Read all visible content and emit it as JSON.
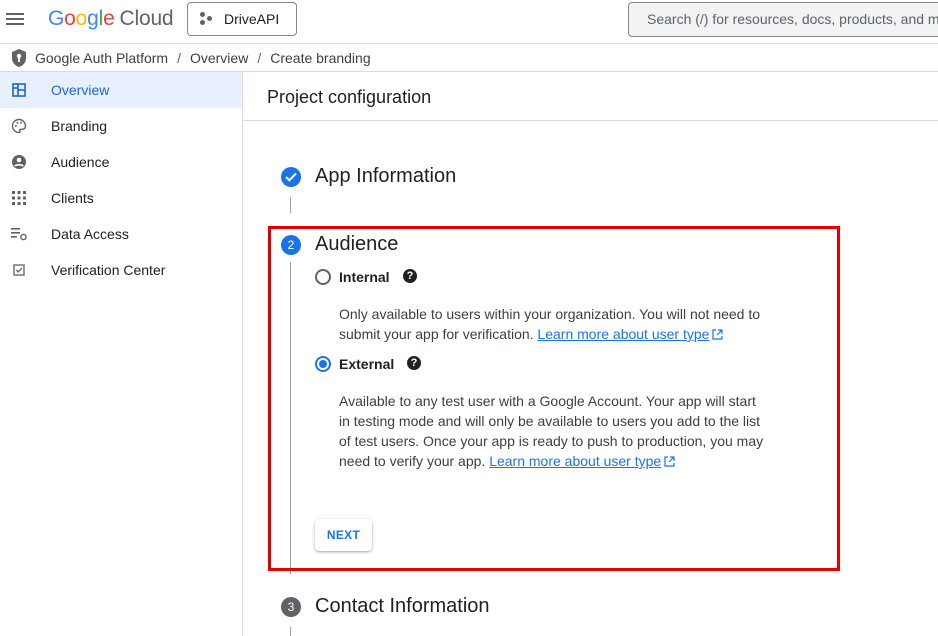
{
  "topbar": {
    "logo_google": [
      "G",
      "o",
      "o",
      "g",
      "l",
      "e"
    ],
    "logo_cloud": "Cloud",
    "project_name": "DriveAPI",
    "search_placeholder": "Search (/) for resources, docs, products, and m"
  },
  "breadcrumb": {
    "items": [
      "Google Auth Platform",
      "Overview",
      "Create branding"
    ],
    "separator": "/"
  },
  "sidebar": {
    "items": [
      {
        "label": "Overview",
        "icon": "dashboard-icon",
        "active": true
      },
      {
        "label": "Branding",
        "icon": "palette-icon",
        "active": false
      },
      {
        "label": "Audience",
        "icon": "account-circle-icon",
        "active": false
      },
      {
        "label": "Clients",
        "icon": "apps-grid-icon",
        "active": false
      },
      {
        "label": "Data Access",
        "icon": "data-access-icon",
        "active": false
      },
      {
        "label": "Verification Center",
        "icon": "checkbox-icon",
        "active": false
      }
    ]
  },
  "main": {
    "title": "Project configuration",
    "steps": [
      {
        "number": "✓",
        "title": "App Information",
        "state": "complete"
      },
      {
        "number": "2",
        "title": "Audience",
        "state": "active"
      },
      {
        "number": "3",
        "title": "Contact Information",
        "state": "pending"
      }
    ],
    "audience": {
      "options": [
        {
          "label": "Internal",
          "checked": false,
          "desc_line1": "Only available to users within your organization. You will not need to",
          "desc_line2": "submit your app for verification.",
          "link": "Learn more about user type"
        },
        {
          "label": "External",
          "checked": true,
          "desc_line1": "Available to any test user with a Google Account. Your app will start",
          "desc_line2": "in testing mode and will only be available to users you add to the list",
          "desc_line3": "of test users. Once your app is ready to push to production, you may",
          "desc_line4": "need to verify your app.",
          "link": "Learn more about user type"
        }
      ],
      "help_glyph": "?",
      "next_label": "NEXT"
    }
  },
  "colors": {
    "accent": "#1a73e8",
    "active_nav_bg": "#e8f0fe",
    "highlight_border": "#e00000",
    "step_complete": "#1a73e8",
    "step_pending": "#5f6368"
  }
}
